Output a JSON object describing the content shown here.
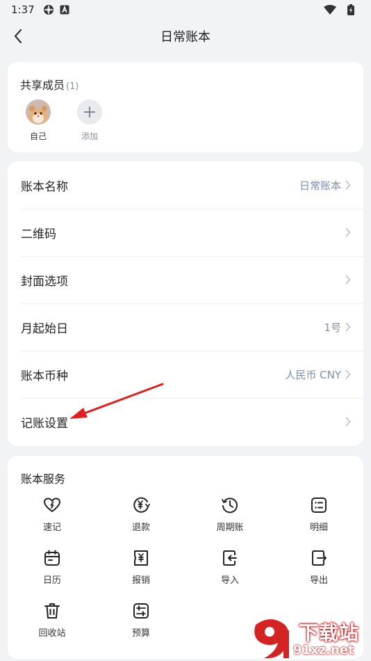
{
  "status_bar": {
    "time": "1:37",
    "icons": [
      "gear-icon",
      "a-box-icon",
      "wifi-icon",
      "battery-icon"
    ]
  },
  "header": {
    "title": "日常账本"
  },
  "members": {
    "label": "共享成员",
    "count": "(1)",
    "items": [
      {
        "name": "自己"
      },
      {
        "name": "添加"
      }
    ]
  },
  "settings": {
    "rows": [
      {
        "label": "账本名称",
        "value": "日常账本"
      },
      {
        "label": "二维码",
        "value": ""
      },
      {
        "label": "封面选项",
        "value": ""
      },
      {
        "label": "月起始日",
        "value": "1号"
      },
      {
        "label": "账本币种",
        "value": "人民币 CNY"
      },
      {
        "label": "记账设置",
        "value": ""
      }
    ]
  },
  "services": {
    "title": "账本服务",
    "items": [
      {
        "label": "速记",
        "icon": "heart-bolt-icon"
      },
      {
        "label": "退款",
        "icon": "yen-refund-icon"
      },
      {
        "label": "周期账",
        "icon": "clock-cycle-icon"
      },
      {
        "label": "明细",
        "icon": "list-detail-icon"
      },
      {
        "label": "日历",
        "icon": "calendar-icon"
      },
      {
        "label": "报销",
        "icon": "yen-ticket-icon"
      },
      {
        "label": "导入",
        "icon": "import-icon"
      },
      {
        "label": "导出",
        "icon": "export-icon"
      },
      {
        "label": "回收站",
        "icon": "trash-icon"
      },
      {
        "label": "预算",
        "icon": "budget-sliders-icon"
      }
    ]
  },
  "annotation": {
    "color": "#e02020"
  },
  "watermark": {
    "brand": "下载站",
    "domain": "91xz.net"
  },
  "colors": {
    "accent": "#7c8fb0",
    "background": "#f2f3f5",
    "card": "#ffffff"
  }
}
